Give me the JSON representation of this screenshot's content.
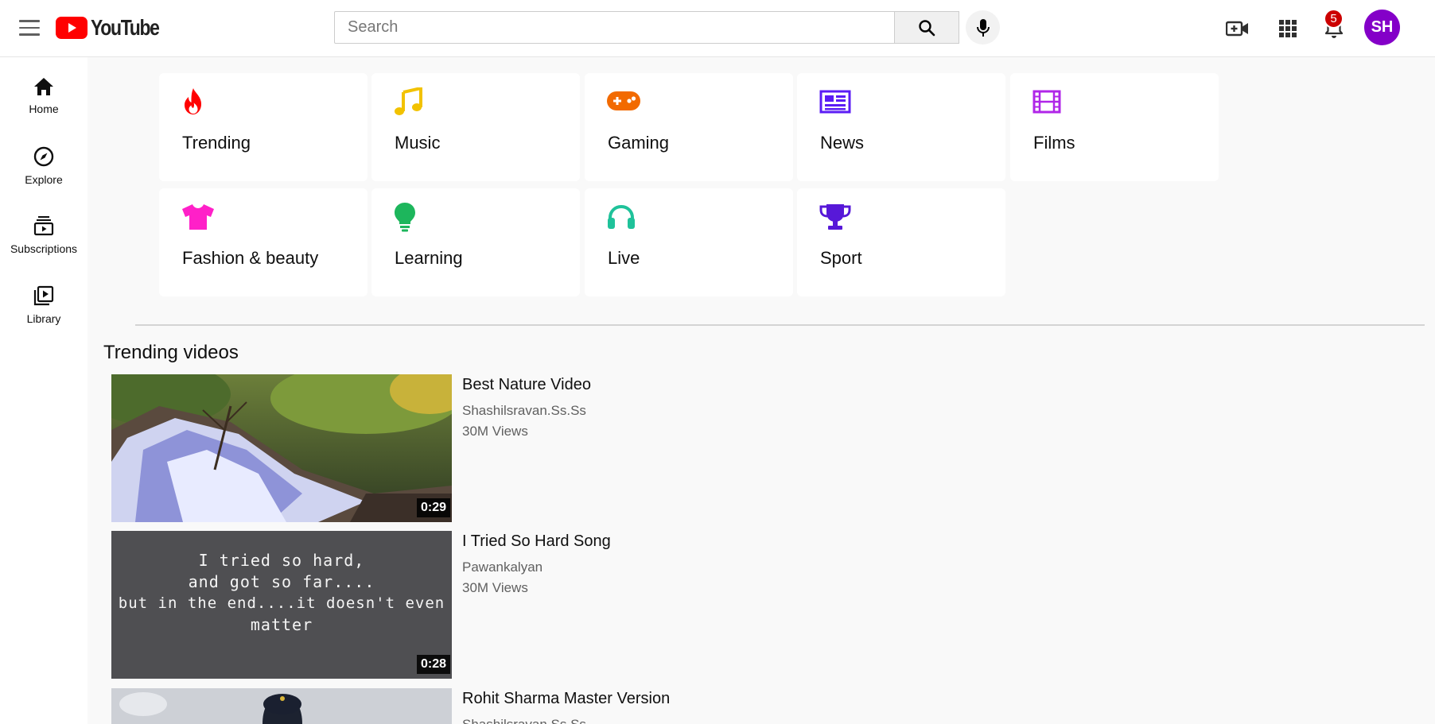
{
  "header": {
    "logo_text": "YouTube",
    "search_placeholder": "Search",
    "notification_count": "5",
    "avatar_initials": "SH"
  },
  "colors": {
    "brand_red": "#ff0000",
    "avatar": "#8400c8",
    "trending": "#ff0000",
    "music": "#f2c200",
    "gaming": "#f26a00",
    "news": "#5b1cf5",
    "films": "#b026e8",
    "fashion": "#ff20c8",
    "learning": "#1db65c",
    "live": "#1fc29a",
    "sport": "#5718d8"
  },
  "sidebar": {
    "items": [
      {
        "label": "Home",
        "icon": "home-icon"
      },
      {
        "label": "Explore",
        "icon": "compass-icon"
      },
      {
        "label": "Subscriptions",
        "icon": "subscriptions-icon"
      },
      {
        "label": "Library",
        "icon": "library-icon"
      }
    ]
  },
  "categories": [
    {
      "label": "Trending",
      "icon": "flame-icon"
    },
    {
      "label": "Music",
      "icon": "music-note-icon"
    },
    {
      "label": "Gaming",
      "icon": "gamepad-icon"
    },
    {
      "label": "News",
      "icon": "newspaper-icon"
    },
    {
      "label": "Films",
      "icon": "film-icon"
    },
    {
      "label": "Fashion & beauty",
      "icon": "tshirt-icon"
    },
    {
      "label": "Learning",
      "icon": "lightbulb-icon"
    },
    {
      "label": "Live",
      "icon": "headphones-icon"
    },
    {
      "label": "Sport",
      "icon": "trophy-icon"
    }
  ],
  "trending_section": {
    "title": "Trending videos",
    "videos": [
      {
        "title": "Best Nature Video",
        "channel": "Shashilsravan.Ss.Ss",
        "views": "30M Views",
        "duration": "0:29"
      },
      {
        "title": "I Tried So Hard Song",
        "channel": "Pawankalyan",
        "views": "30M Views",
        "duration": "0:28",
        "thumb_text": [
          "I tried so hard,",
          "and got so far....",
          "but in the end....it doesn't even",
          "matter"
        ]
      },
      {
        "title": "Rohit Sharma Master Version",
        "channel": "Shashilsravan.Ss.Ss",
        "views": "",
        "duration": ""
      }
    ]
  }
}
